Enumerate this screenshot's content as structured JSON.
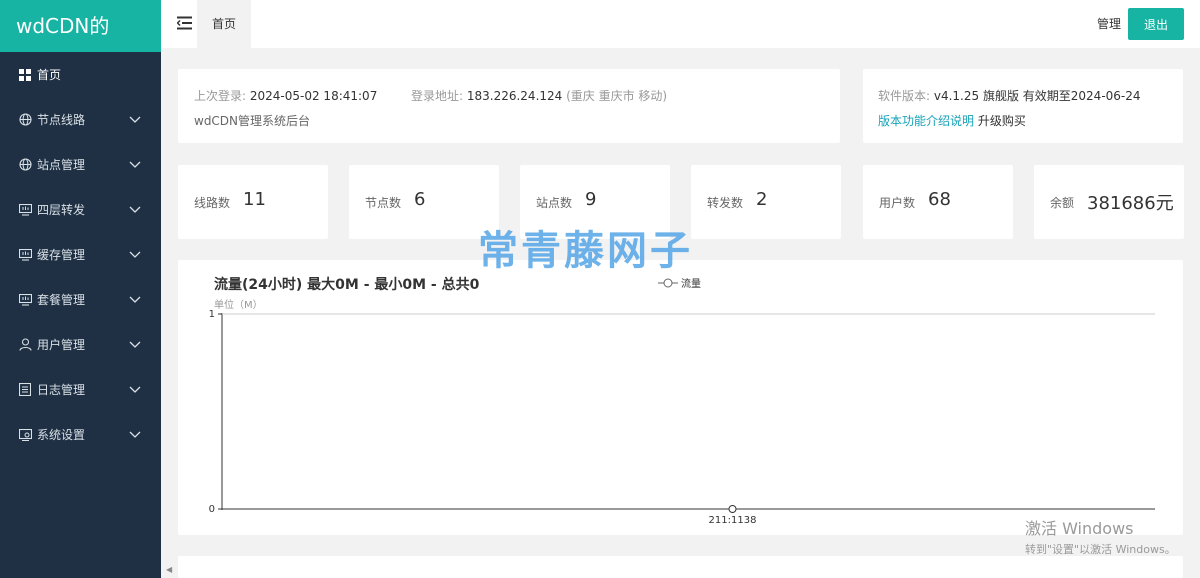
{
  "app": {
    "logo": "wdCDN的"
  },
  "sidebar": {
    "items": [
      {
        "label": "首页",
        "icon": "grid-icon"
      },
      {
        "label": "节点线路",
        "icon": "globe-icon"
      },
      {
        "label": "站点管理",
        "icon": "globe-icon"
      },
      {
        "label": "四层转发",
        "icon": "monitor-icon"
      },
      {
        "label": "缓存管理",
        "icon": "monitor-icon"
      },
      {
        "label": "套餐管理",
        "icon": "monitor-icon"
      },
      {
        "label": "用户管理",
        "icon": "user-icon"
      },
      {
        "label": "日志管理",
        "icon": "document-icon"
      },
      {
        "label": "系统设置",
        "icon": "settings-icon"
      }
    ]
  },
  "header": {
    "tab": "首页",
    "manage": "管理",
    "logout": "退出"
  },
  "info": {
    "last_login_label": "上次登录:",
    "last_login_value": "2024-05-02 18:41:07",
    "login_addr_label": "登录地址:",
    "login_addr_ip": "183.226.24.124",
    "login_addr_loc": "(重庆 重庆市 移动)",
    "system_name": "wdCDN管理系统后台"
  },
  "version": {
    "label": "软件版本:",
    "value": "v4.1.25 旗舰版 有效期至2024-06-24",
    "intro_link": "版本功能介绍说明",
    "upgrade_link": "升级购买"
  },
  "stats": [
    {
      "label": "线路数",
      "value": "11"
    },
    {
      "label": "节点数",
      "value": "6"
    },
    {
      "label": "站点数",
      "value": "9"
    },
    {
      "label": "转发数",
      "value": "2"
    },
    {
      "label": "用户数",
      "value": "68"
    },
    {
      "label": "余额",
      "value": "381686元"
    }
  ],
  "chart_data": {
    "type": "line",
    "title": "流量(24小时)  最大0M - 最小0M - 总共0",
    "ylabel": "单位（M）",
    "ylim": [
      0,
      1
    ],
    "yticks": [
      "1",
      "0"
    ],
    "grid": true,
    "legend_position": "top-center",
    "x": [
      "211:1138"
    ],
    "series": [
      {
        "name": "流量",
        "values": [
          0
        ]
      }
    ]
  },
  "watermark": "常青藤网子",
  "os_notice": {
    "line1": "激活 Windows",
    "line2": "转到\"设置\"以激活 Windows。"
  },
  "colors": {
    "accent": "#17b3a3",
    "sidebar_bg": "#1f3044",
    "link": "#17a2b8"
  }
}
